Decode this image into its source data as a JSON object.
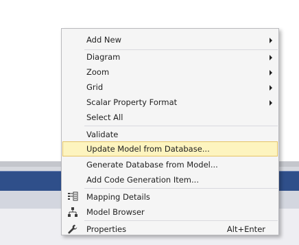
{
  "menu": {
    "items": [
      {
        "label": "Add New",
        "submenu": true
      },
      {
        "label": "Diagram",
        "submenu": true
      },
      {
        "label": "Zoom",
        "submenu": true
      },
      {
        "label": "Grid",
        "submenu": true
      },
      {
        "label": "Scalar Property Format",
        "submenu": true
      },
      {
        "label": "Select All"
      },
      {
        "label": "Validate"
      },
      {
        "label": "Update Model from Database...",
        "highlighted": true
      },
      {
        "label": "Generate Database from Model..."
      },
      {
        "label": "Add Code Generation Item..."
      },
      {
        "label": "Mapping Details",
        "icon": "mapping-details-icon"
      },
      {
        "label": "Model Browser",
        "icon": "model-browser-icon"
      },
      {
        "label": "Properties",
        "icon": "wrench-icon",
        "shortcut": "Alt+Enter"
      }
    ]
  },
  "colors": {
    "highlight_bg": "#fdf4bf",
    "highlight_border": "#e5c365",
    "menu_bg": "#f5f5f5",
    "status_bar": "#2f4f8a"
  }
}
